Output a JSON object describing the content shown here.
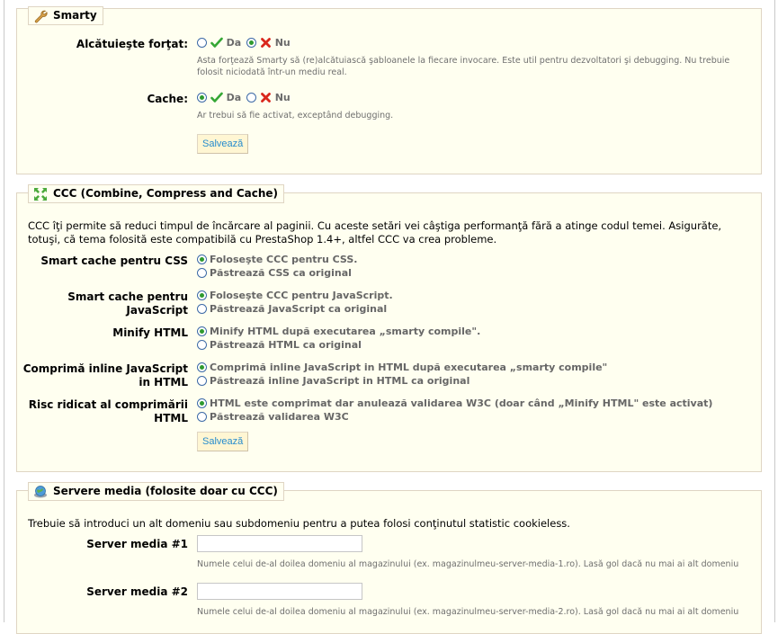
{
  "smarty": {
    "legend": "Smarty",
    "force_compile": {
      "label": "Alcătuieşte forţat:",
      "yes": "Da",
      "no": "Nu",
      "hint": "Asta forţează Smarty să (re)alcătuiască şabloanele la fiecare invocare. Este util pentru dezvoltatori şi debugging. Nu trebuie folosit niciodată într-un mediu real."
    },
    "cache": {
      "label": "Cache:",
      "yes": "Da",
      "no": "Nu",
      "hint": "Ar trebui să fie activat, exceptând debugging."
    },
    "save_label": "Salvează"
  },
  "ccc": {
    "legend": "CCC (Combine, Compress and Cache)",
    "intro": "CCC îţi permite să reduci timpul de încărcare al paginii. Cu aceste setări vei câştiga performanţă fără a atinge codul temei. Asigurăte, totuşi, că tema folosită este compatibilă cu PrestaShop 1.4+, altfel CCC va crea probleme.",
    "settings": [
      {
        "label": "Smart cache pentru CSS",
        "options": [
          "Foloseşte CCC pentru CSS.",
          "Păstrează CSS ca original"
        ],
        "selected": 0
      },
      {
        "label": "Smart cache pentru JavaScript",
        "options": [
          "Foloseşte CCC pentru JavaScript.",
          "Păstrează JavaScript ca original"
        ],
        "selected": 0
      },
      {
        "label": "Minify HTML",
        "options": [
          "Minify HTML după executarea „smarty compile\".",
          "Păstrează HTML ca original"
        ],
        "selected": 0
      },
      {
        "label": "Comprimă inline JavaScript in HTML",
        "options": [
          "Comprimă inline JavaScript in HTML după executarea „smarty compile\"",
          "Păstrează inline JavaScript in HTML ca original"
        ],
        "selected": 0
      },
      {
        "label": "Risc ridicat al comprimării HTML",
        "options": [
          "HTML este comprimat dar anulează validarea W3C (doar când „Minify HTML\" este activat)",
          "Păstrează validarea W3C"
        ],
        "selected": 0
      }
    ],
    "save_label": "Salvează"
  },
  "media": {
    "legend": "Servere media (folosite doar cu CCC)",
    "intro": "Trebuie să introduci un alt domeniu sau subdomeniu pentru a putea folosi conţinutul statistic cookieless.",
    "servers": [
      {
        "label": "Server media #1",
        "value": "",
        "hint": "Numele celui de-al doilea domeniu al magazinului (ex. magazinulmeu-server-media-1.ro). Lasă gol dacă nu mai ai alt domeniu"
      },
      {
        "label": "Server media #2",
        "value": "",
        "hint": "Numele celui de-al doilea domeniu al magazinului (ex. magazinulmeu-server-media-2.ro). Lasă gol dacă nu mai ai alt domeniu"
      }
    ]
  },
  "colors": {
    "panel_bg": "#fffff0",
    "panel_border": "#dfd5c3",
    "button_text": "#268ccd",
    "check_green": "#35a735",
    "cross_red": "#d9271c"
  }
}
